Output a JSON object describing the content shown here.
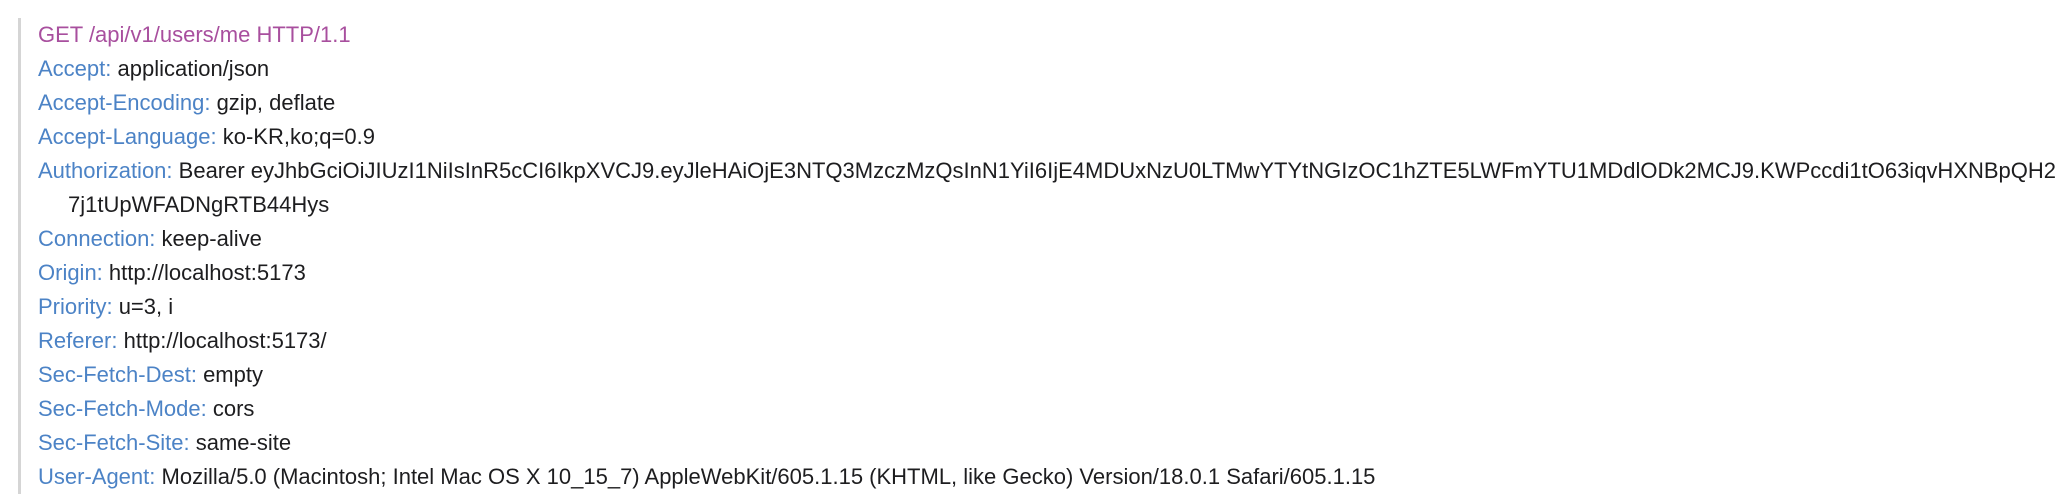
{
  "request_line": "GET /api/v1/users/me HTTP/1.1",
  "colors": {
    "request_line": "#a84f9e",
    "header_name": "#4c83c6",
    "header_value": "#1d1d1f",
    "gutter": "#d5d5d5"
  },
  "headers": [
    {
      "name": "Accept:",
      "value": "application/json"
    },
    {
      "name": "Accept-Encoding:",
      "value": "gzip, deflate"
    },
    {
      "name": "Accept-Language:",
      "value": "ko-KR,ko;q=0.9"
    },
    {
      "name": "Authorization:",
      "value": "Bearer eyJhbGciOiJIUzI1NiIsInR5cCI6IkpXVCJ9.eyJleHAiOjE3NTQ3MzczMzQsInN1YiI6IjE4MDUxNzU0LTMwYTYtNGIzOC1hZTE5LWFmYTU1MDdlODk2MCJ9.KWPccdi1tO63iqvHXNBpQH27j1tUpWFADNgRTB44Hys"
    },
    {
      "name": "Connection:",
      "value": "keep-alive"
    },
    {
      "name": "Origin:",
      "value": "http://localhost:5173"
    },
    {
      "name": "Priority:",
      "value": "u=3, i"
    },
    {
      "name": "Referer:",
      "value": "http://localhost:5173/"
    },
    {
      "name": "Sec-Fetch-Dest:",
      "value": "empty"
    },
    {
      "name": "Sec-Fetch-Mode:",
      "value": "cors"
    },
    {
      "name": "Sec-Fetch-Site:",
      "value": "same-site"
    },
    {
      "name": "User-Agent:",
      "value": "Mozilla/5.0 (Macintosh; Intel Mac OS X 10_15_7) AppleWebKit/605.1.15 (KHTML, like Gecko) Version/18.0.1 Safari/605.1.15"
    }
  ]
}
